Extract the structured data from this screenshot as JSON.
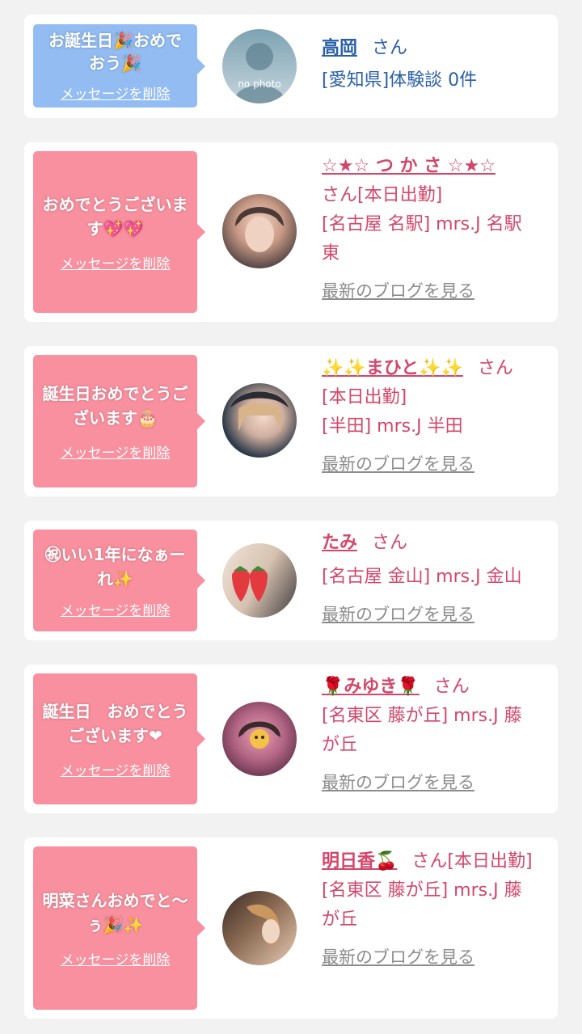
{
  "cards": [
    {
      "message": "お誕生日🎉おめでおう🎉",
      "delete_label": "メッセージを削除",
      "name": "高岡",
      "san": "さん",
      "lines": [
        "[愛知県]体験談 0件"
      ],
      "avatar_text": "no photo",
      "bubble_color": "#93bcf2",
      "text_color": "#2a5fa8"
    },
    {
      "message": "おめでとうございます💖💖",
      "delete_label": "メッセージを削除",
      "name": "☆★☆ つ か さ ☆★☆",
      "san": "さん[本日出勤]",
      "lines": [
        "[名古屋 名駅] mrs.J 名駅東"
      ],
      "blog": "最新のブログを見る",
      "bubble_color": "#f8909f",
      "text_color": "#d4466a"
    },
    {
      "message": "誕生日おめでとうございます🎂",
      "delete_label": "メッセージを削除",
      "name": "✨✨まひと✨✨",
      "san": "さん",
      "lines": [
        "[本日出勤]",
        "[半田] mrs.J 半田"
      ],
      "blog": "最新のブログを見る",
      "bubble_color": "#f8909f",
      "text_color": "#d4466a"
    },
    {
      "message": "㊗いい1年になぁーれ✨",
      "delete_label": "メッセージを削除",
      "name": "たみ",
      "san": "さん",
      "lines": [
        "[名古屋 金山] mrs.J 金山"
      ],
      "blog": "最新のブログを見る",
      "bubble_color": "#f8909f",
      "text_color": "#d4466a"
    },
    {
      "message": "誕生日　おめでとうございます❤",
      "delete_label": "メッセージを削除",
      "name": "🌹みゆき🌹",
      "san": "さん",
      "lines": [
        "[名東区 藤が丘] mrs.J 藤が丘"
      ],
      "blog": "最新のブログを見る",
      "bubble_color": "#f8909f",
      "text_color": "#d4466a"
    },
    {
      "message": "明菜さんおめでと〜ぅ🎉✨",
      "delete_label": "メッセージを削除",
      "name": "明日香🍒",
      "san": "さん[本日出勤]",
      "lines": [
        "[名東区 藤が丘] mrs.J 藤が丘"
      ],
      "blog": "最新のブログを見る",
      "bubble_color": "#f8909f",
      "text_color": "#d4466a"
    }
  ]
}
